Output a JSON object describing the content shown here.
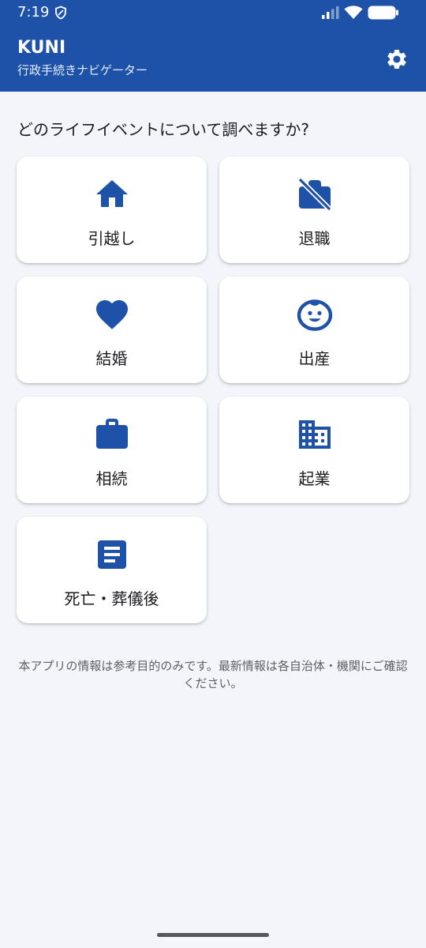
{
  "status_bar": {
    "time": "7:19",
    "icons": [
      "shield-icon",
      "signal-icon",
      "wifi-icon",
      "battery-icon"
    ]
  },
  "header": {
    "title": "KUNI",
    "subtitle": "行政手続きナビゲーター",
    "settings_icon": "gear-icon",
    "background_color": "#1d52a8"
  },
  "main": {
    "heading": "どのライフイベントについて調べますか?",
    "events": [
      {
        "label": "引越し",
        "icon": "home-icon"
      },
      {
        "label": "退職",
        "icon": "work-off-icon"
      },
      {
        "label": "結婚",
        "icon": "heart-icon"
      },
      {
        "label": "出産",
        "icon": "baby-face-icon"
      },
      {
        "label": "相続",
        "icon": "briefcase-icon"
      },
      {
        "label": "起業",
        "icon": "office-building-icon"
      },
      {
        "label": "死亡・葬儀後",
        "icon": "document-icon"
      }
    ],
    "disclaimer": "本アプリの情報は参考目的のみです。最新情報は各自治体・機関にご確認ください。"
  },
  "colors": {
    "accent": "#1d52a8",
    "background": "#f4f5fa",
    "card": "#ffffff",
    "text": "#1b1b1f",
    "muted_text": "#5f6168"
  }
}
